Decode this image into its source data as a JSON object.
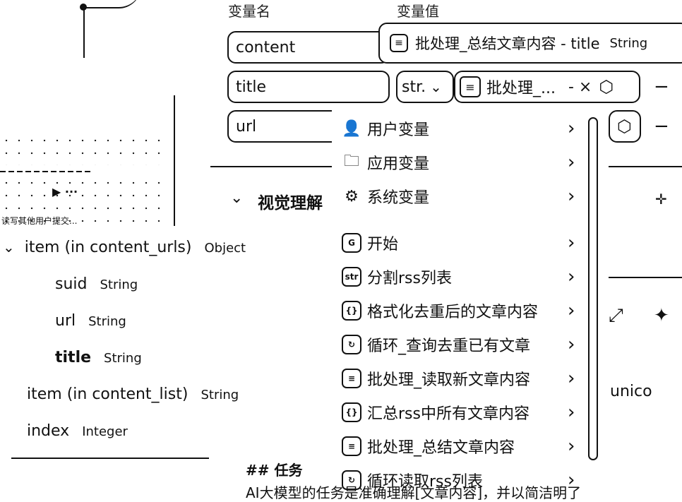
{
  "headers": {
    "var_name": "变量名",
    "var_value": "变量值"
  },
  "rows": [
    {
      "name": "content"
    },
    {
      "name": "title",
      "type_select": "str.",
      "ref_label": "批处理_...",
      "ref_suffix": "- ×"
    },
    {
      "name": "url"
    }
  ],
  "tooltip": {
    "label": "批处理_总结文章内容 - title",
    "type": "String"
  },
  "minus_label": "−",
  "section": {
    "label": "视觉理解",
    "visible_text": "视觉理解"
  },
  "left_panel": {
    "play_label": "▶ ···",
    "note": "读写其他用户提交..."
  },
  "tree": [
    {
      "label": "item (in content_urls)",
      "type": "Object"
    },
    {
      "label": "suid",
      "type": "String"
    },
    {
      "label": "url",
      "type": "String"
    },
    {
      "label": "title",
      "type": "String"
    },
    {
      "label": "item (in content_list)",
      "type": "String"
    },
    {
      "label": "index",
      "type": "Integer"
    }
  ],
  "menu": {
    "items": [
      {
        "label": "用户变量",
        "icon": "user-icon"
      },
      {
        "label": "应用变量",
        "icon": "folder-icon"
      },
      {
        "label": "系统变量",
        "icon": "gear-icon"
      },
      {
        "label": "开始",
        "icon": "start-icon"
      },
      {
        "label": "分割rss列表",
        "icon": "split-icon"
      },
      {
        "label": "格式化去重后的文章内容",
        "icon": "code-icon"
      },
      {
        "label": "循环_查询去重已有文章",
        "icon": "loop-icon"
      },
      {
        "label": "批处理_读取新文章内容",
        "icon": "batch-icon"
      },
      {
        "label": "汇总rss中所有文章内容",
        "icon": "code-icon"
      },
      {
        "label": "批处理_总结文章内容",
        "icon": "batch-icon"
      },
      {
        "label": "循环读取rss列表",
        "icon": "loop-icon"
      }
    ]
  },
  "right_text": "unico",
  "bottom": {
    "heading": "## 任务",
    "body": "AI大模型的任务是准确理解[文章内容]，并以简洁明了"
  }
}
